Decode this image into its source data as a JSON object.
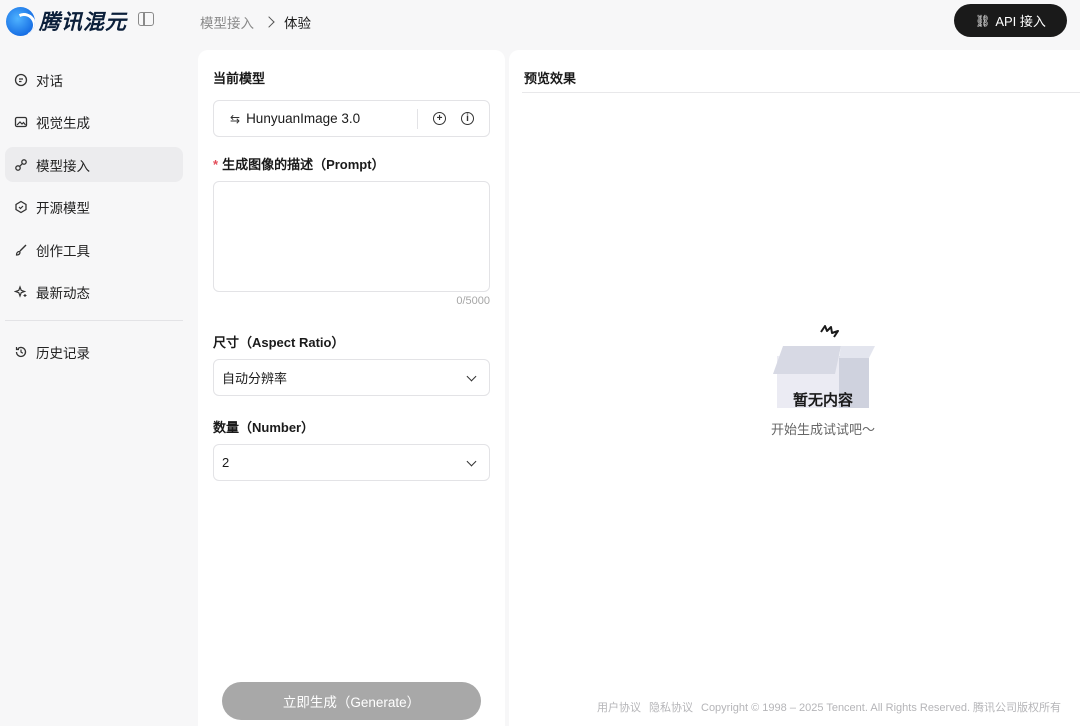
{
  "brand": {
    "name": "腾讯混元"
  },
  "breadcrumb": {
    "parent": "模型接入",
    "current": "体验"
  },
  "header": {
    "api_button": "API 接入"
  },
  "sidebar": {
    "items": [
      {
        "label": "对话",
        "icon": "chat-icon"
      },
      {
        "label": "视觉生成",
        "icon": "image-icon"
      },
      {
        "label": "模型接入",
        "icon": "model-access-icon",
        "active": true
      },
      {
        "label": "开源模型",
        "icon": "open-source-icon"
      },
      {
        "label": "创作工具",
        "icon": "brush-icon"
      },
      {
        "label": "最新动态",
        "icon": "sparkle-icon"
      }
    ],
    "history": {
      "label": "历史记录",
      "icon": "history-icon"
    }
  },
  "form": {
    "model_label": "当前模型",
    "model_name": "HunyuanImage 3.0",
    "prompt_label": "生成图像的描述（Prompt）",
    "prompt_value": "",
    "prompt_counter": "0/5000",
    "size_label": "尺寸（Aspect Ratio）",
    "size_value": "自动分辨率",
    "number_label": "数量（Number）",
    "number_value": "2",
    "generate_button": "立即生成（Generate）"
  },
  "preview": {
    "title": "预览效果",
    "empty_title": "暂无内容",
    "empty_subtitle": "开始生成试试吧～"
  },
  "footer": {
    "user_agreement": "用户协议",
    "privacy": "隐私协议",
    "copyright": "Copyright © 1998 – 2025 Tencent. All Rights Reserved. 腾讯公司版权所有"
  }
}
